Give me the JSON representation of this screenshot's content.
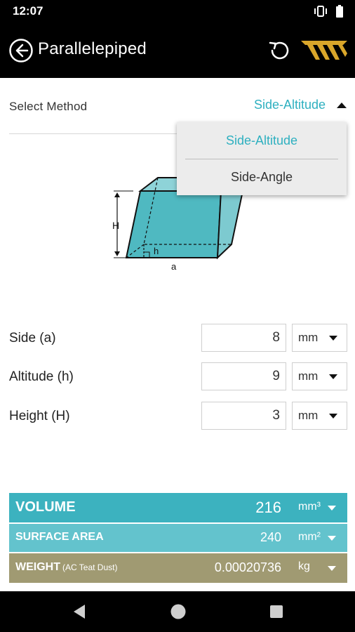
{
  "status_bar": {
    "time": "12:07",
    "icons": [
      "vibrate-icon",
      "battery-icon"
    ]
  },
  "app_bar": {
    "title": "Parallelepiped",
    "icons": [
      "back-icon",
      "reset-icon",
      "logo-icon"
    ]
  },
  "method": {
    "label": "Select Method",
    "selected": "Side-Altitude",
    "options": [
      "Side-Altitude",
      "Side-Angle"
    ]
  },
  "diagram": {
    "label_H": "H",
    "label_h": "h",
    "label_a": "a"
  },
  "inputs": [
    {
      "label": "Side (a)",
      "value": "8",
      "unit": "mm"
    },
    {
      "label": "Altitude (h)",
      "value": "9",
      "unit": "mm"
    },
    {
      "label": "Height (H)",
      "value": "3",
      "unit": "mm"
    }
  ],
  "results": {
    "volume": {
      "label": "VOLUME",
      "value": "216",
      "unit": "mm³"
    },
    "surface_area": {
      "label": "SURFACE AREA",
      "value": "240",
      "unit": "mm²"
    },
    "weight": {
      "label": "WEIGHT",
      "note": "(AC Teat Dust)",
      "value": "0.00020736",
      "unit": "kg"
    }
  },
  "colors": {
    "accent": "#2eb0c0",
    "volume_bg": "#3cb2bf",
    "surface_bg": "#63c3cd",
    "weight_bg": "#a09a72",
    "logo": "#d9a62a"
  },
  "nav_bar": {
    "icons": [
      "nav-back-icon",
      "nav-home-icon",
      "nav-recent-icon"
    ]
  }
}
